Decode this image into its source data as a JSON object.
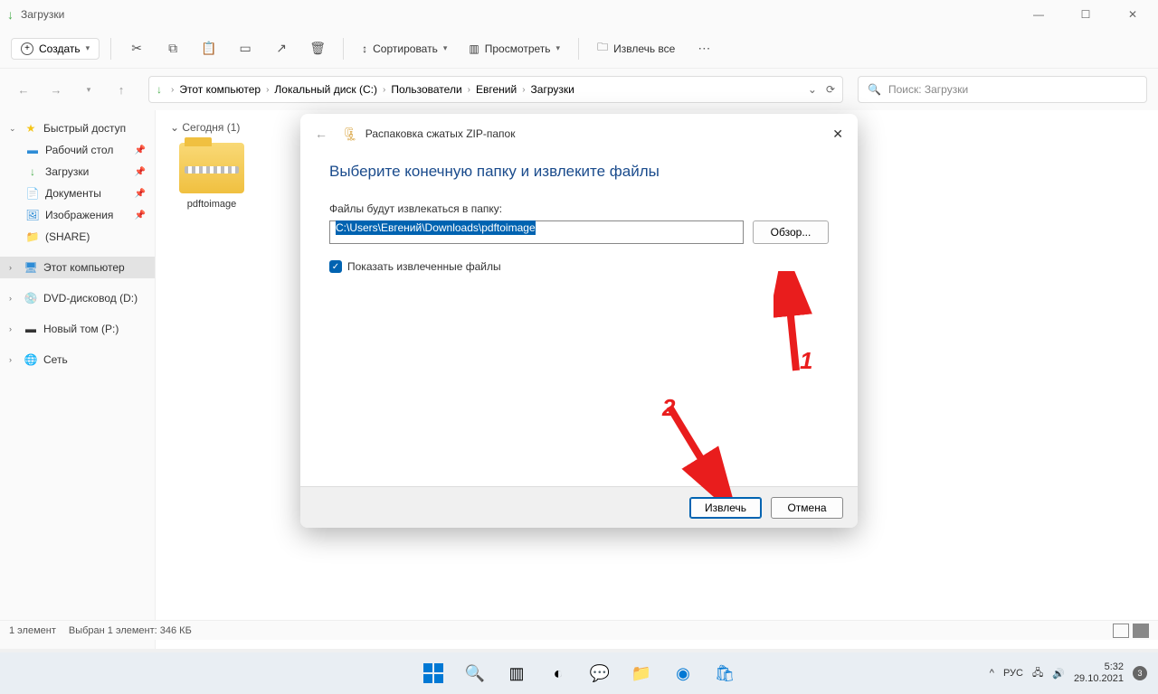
{
  "window": {
    "title": "Загрузки"
  },
  "toolbar": {
    "create": "Создать",
    "sort": "Сортировать",
    "view": "Просмотреть",
    "extract_all": "Извлечь все"
  },
  "breadcrumb": {
    "items": [
      "Этот компьютер",
      "Локальный диск (C:)",
      "Пользователи",
      "Евгений",
      "Загрузки"
    ]
  },
  "search": {
    "placeholder": "Поиск: Загрузки"
  },
  "sidebar": {
    "quick_access": "Быстрый доступ",
    "desktop": "Рабочий стол",
    "downloads": "Загрузки",
    "documents": "Документы",
    "pictures": "Изображения",
    "share": "(SHARE)",
    "this_pc": "Этот компьютер",
    "dvd": "DVD-дисковод (D:)",
    "newvol": "Новый том (P:)",
    "network": "Сеть"
  },
  "content": {
    "group": "Сегодня (1)",
    "file_name": "pdftoimage"
  },
  "statusbar": {
    "count": "1 элемент",
    "selection": "Выбран 1 элемент: 346 КБ"
  },
  "dialog": {
    "title": "Распаковка сжатых ZIP-папок",
    "heading": "Выберите конечную папку и извлеките файлы",
    "label_dest": "Файлы будут извлекаться в папку:",
    "path": "C:\\Users\\Евгений\\Downloads\\pdftoimage",
    "browse": "Обзор...",
    "show_files": "Показать извлеченные файлы",
    "extract": "Извлечь",
    "cancel": "Отмена"
  },
  "annotations": {
    "num1": "1",
    "num2": "2"
  },
  "taskbar": {
    "lang": "РУС",
    "time": "5:32",
    "date": "29.10.2021",
    "badge": "3"
  }
}
